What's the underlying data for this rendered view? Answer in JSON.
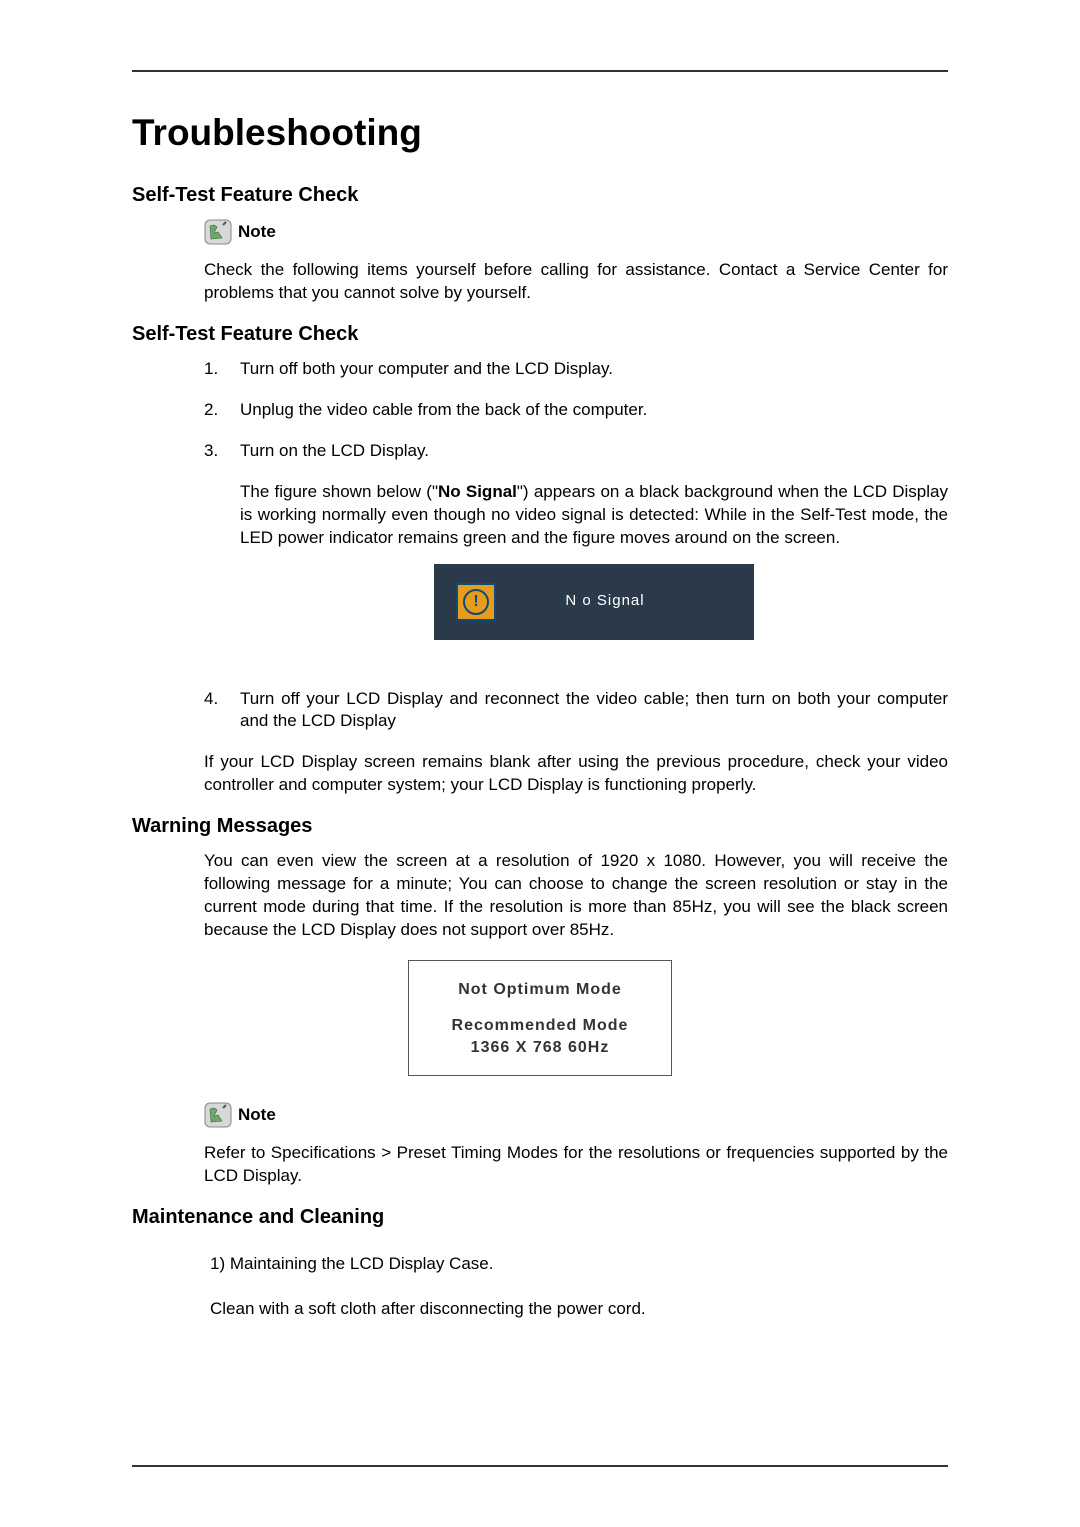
{
  "title": "Troubleshooting",
  "section1": {
    "heading": "Self-Test Feature Check",
    "note_label": "Note",
    "intro": "Check the following items yourself before calling for assistance. Contact a Service Center for problems that you cannot solve by yourself."
  },
  "section2": {
    "heading": "Self-Test Feature Check",
    "steps": [
      {
        "num": "1.",
        "text": "Turn off both your computer and the LCD Display."
      },
      {
        "num": "2.",
        "text": "Unplug the video cable from the back of the computer."
      },
      {
        "num": "3.",
        "text": "Turn on the LCD Display.",
        "extra_pre": "The figure shown below (\"",
        "extra_bold": "No Signal",
        "extra_post": "\") appears on a black background when the LCD Display is working normally even though no video signal is detected: While in the Self-Test mode, the LED power indicator remains green and the figure moves around on the screen."
      },
      {
        "num": "4.",
        "text": "Turn off your LCD Display and reconnect the video cable; then turn on both your computer and the LCD Display"
      }
    ],
    "no_signal_text": "N o Signal",
    "closing": "If your LCD Display screen remains blank after using the previous procedure, check your video controller and computer system; your LCD Display is functioning properly."
  },
  "section3": {
    "heading": "Warning Messages",
    "body": "You can even view the screen at a resolution of 1920 x 1080. However, you will receive the following message for a minute; You can choose to change the screen resolution or stay in the current mode during that time. If the resolution is more than 85Hz, you will see the black screen because the LCD Display does not support over 85Hz.",
    "box": {
      "line1": "Not Optimum Mode",
      "line2": "Recommended Mode",
      "line3": "1366 X 768 60Hz"
    },
    "note_label": "Note",
    "note_body": "Refer to Specifications > Preset Timing Modes for the resolutions or frequencies supported by the LCD Display."
  },
  "section4": {
    "heading": "Maintenance and Cleaning",
    "line1": "1) Maintaining the LCD Display Case.",
    "line2": "Clean with a soft cloth after disconnecting the power cord."
  }
}
